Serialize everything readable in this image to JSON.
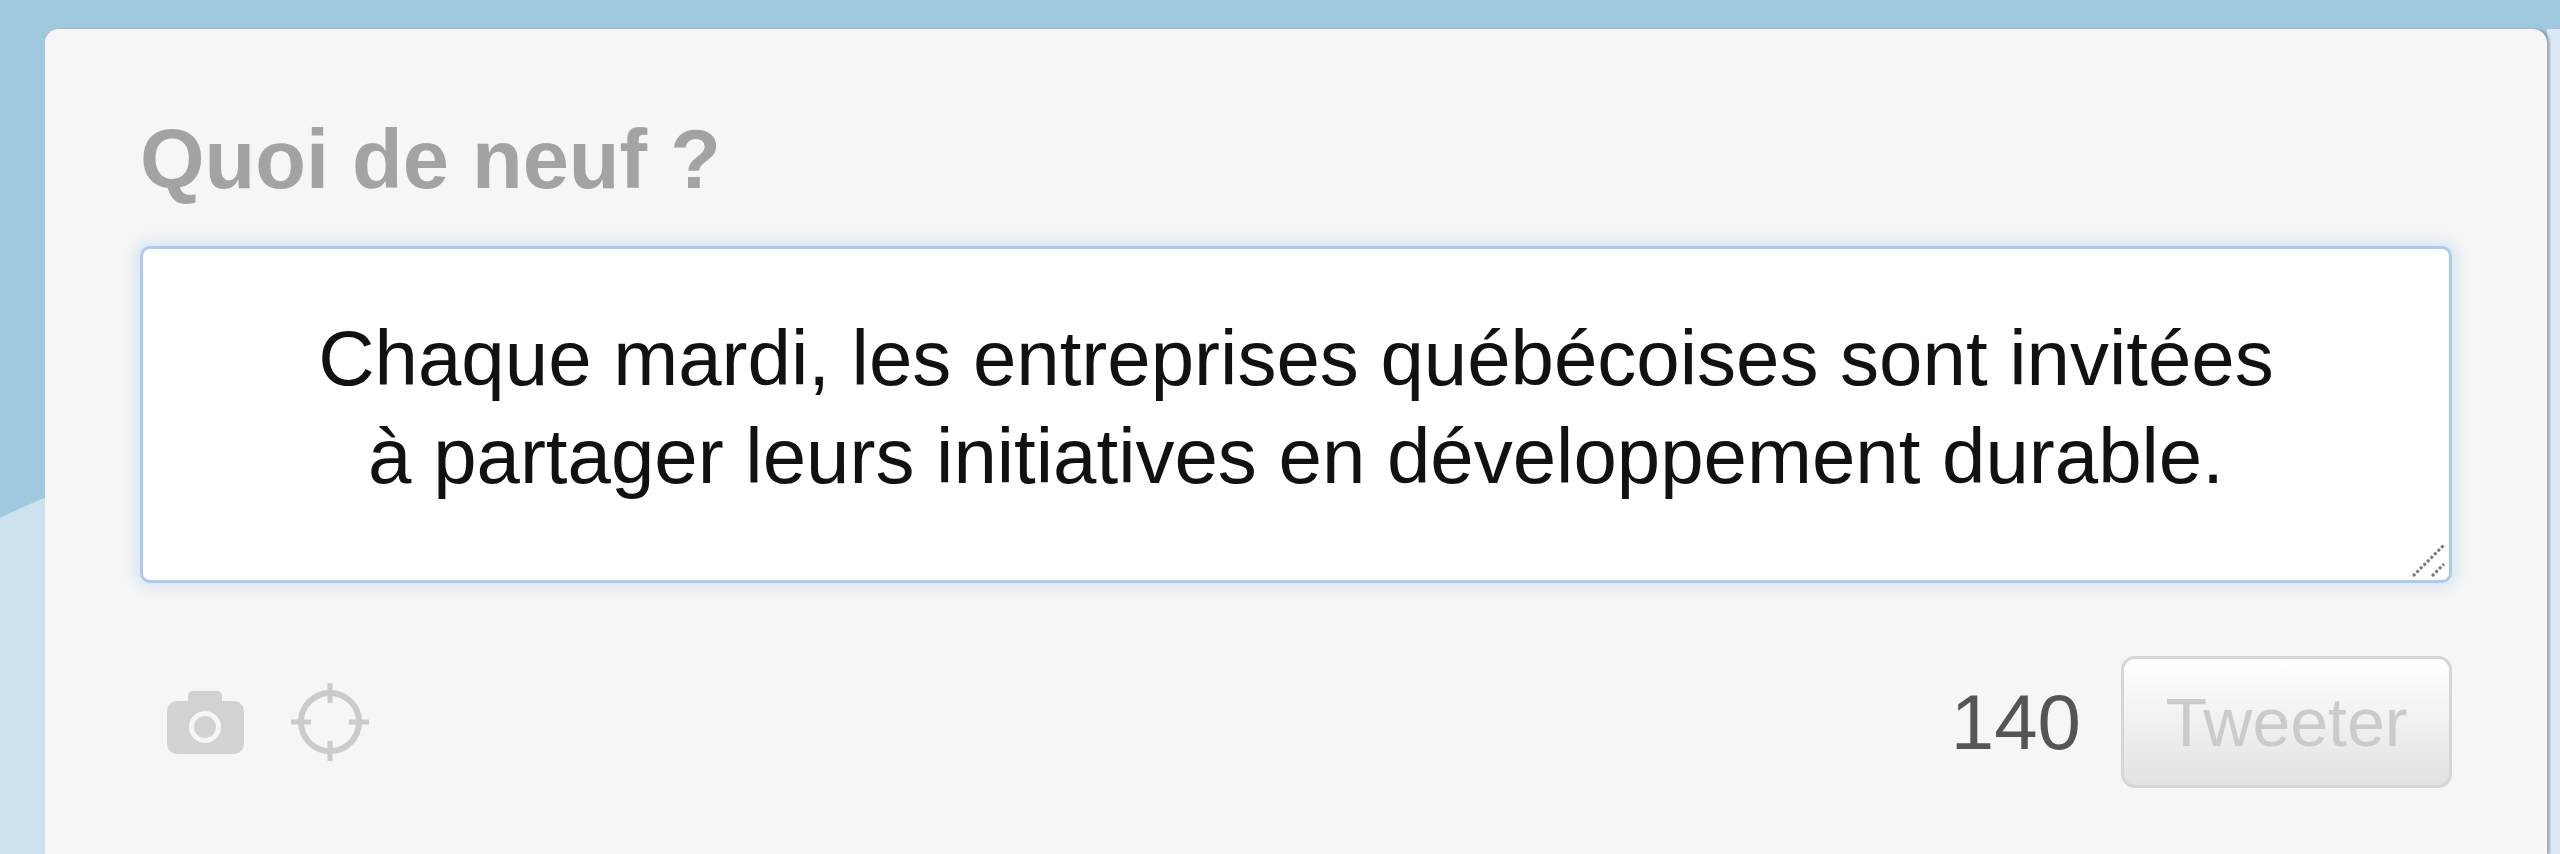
{
  "compose": {
    "title": "Quoi de neuf ?",
    "tweet": {
      "value": "Chaque mardi, les entreprises québécoises sont invitées à partager leurs initiatives en développement durable."
    },
    "counter": "140",
    "submit": {
      "label": "Tweeter",
      "disabled": true
    }
  }
}
